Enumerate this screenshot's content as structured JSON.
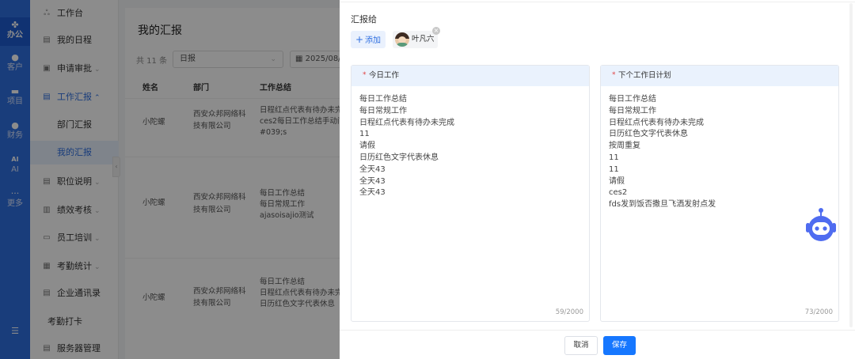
{
  "rail": {
    "items": [
      {
        "icon": "office-icon",
        "label": "办公"
      },
      {
        "icon": "customer-icon",
        "label": "客户"
      },
      {
        "icon": "project-icon",
        "label": "项目"
      },
      {
        "icon": "finance-icon",
        "label": "财务"
      },
      {
        "icon": "ai-icon",
        "label": "AI"
      },
      {
        "icon": "more-icon",
        "label": "更多"
      }
    ],
    "ai_glyph": "AI",
    "more_glyph": "···"
  },
  "nav": {
    "workbench": "工作台",
    "my_schedule": "我的日程",
    "approval": "申请审批",
    "work_report": "工作汇报",
    "dept_report": "部门汇报",
    "my_report": "我的汇报",
    "job_desc": "职位说明",
    "performance": "绩效考核",
    "training": "员工培训",
    "attendance": "考勤统计",
    "contacts": "企业通讯录",
    "clock_in": "考勤打卡",
    "server_mgmt": "服务器管理"
  },
  "main": {
    "title": "我的汇报",
    "count": "共 11 条",
    "type_select": "日报",
    "date": "2025/08/",
    "columns": [
      "姓名",
      "部门",
      "工作总结"
    ],
    "rows": [
      {
        "name": "小陀螺",
        "dept": [
          "西安众邦网络科",
          "技有限公司"
        ],
        "summary": [
          "日程红点代表有待办未完",
          "ces2每日工作总结手动间",
          "#039;s"
        ]
      },
      {
        "name": "小陀螺",
        "dept": [
          "西安众邦网络科",
          "技有限公司"
        ],
        "summary": [
          "每日工作总结",
          "每日常规工作",
          "ajasoisajio测试"
        ]
      },
      {
        "name": "小陀螺",
        "dept": [
          "西安众邦网络科",
          "技有限公司"
        ],
        "summary": [
          "每日工作总结",
          "日程红点代表有待办未完",
          "日历红色文字代表休息"
        ]
      }
    ]
  },
  "drawer": {
    "report_to_label": "汇报给",
    "add_label": "添加",
    "recipient": "叶凡六",
    "today": {
      "title": "今日工作",
      "lines": [
        "每日工作总结",
        "每日常规工作",
        "日程红点代表有待办未完成",
        "11",
        "请假",
        "日历红色文字代表休息",
        "全天43",
        "全天43",
        "全天43"
      ],
      "counter": "59/2000"
    },
    "next": {
      "title": "下个工作日计划",
      "lines": [
        "每日工作总结",
        "每日常规工作",
        "日程红点代表有待办未完成",
        "日历红色文字代表休息",
        "按周重复",
        "11",
        "11",
        "请假",
        "ces2",
        "fds发到饭否撒旦飞洒发射点发"
      ],
      "counter": "73/2000"
    },
    "cancel": "取消",
    "save": "保存"
  },
  "colors": {
    "rail": "#2f6fe0",
    "accent": "#1677ff",
    "panel_head": "#eaf2fd",
    "required": "#e04040"
  }
}
